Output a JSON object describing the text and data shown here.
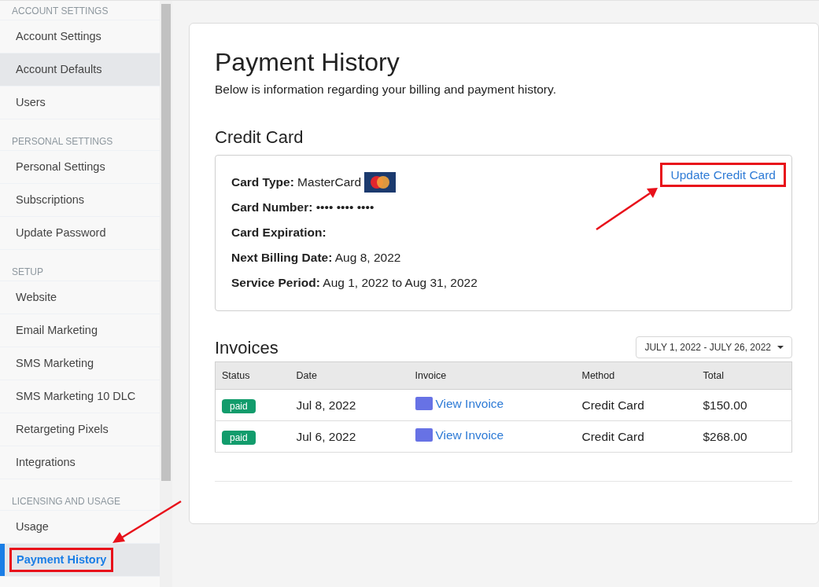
{
  "sidebar": {
    "sections": [
      {
        "title": "ACCOUNT SETTINGS",
        "items": [
          {
            "label": "Account Settings",
            "selected": false,
            "hovered": false,
            "outlined": false
          },
          {
            "label": "Account Defaults",
            "selected": false,
            "hovered": true,
            "outlined": false
          },
          {
            "label": "Users",
            "selected": false,
            "hovered": false,
            "outlined": false
          }
        ]
      },
      {
        "title": "PERSONAL SETTINGS",
        "items": [
          {
            "label": "Personal Settings",
            "selected": false,
            "hovered": false,
            "outlined": false
          },
          {
            "label": "Subscriptions",
            "selected": false,
            "hovered": false,
            "outlined": false
          },
          {
            "label": "Update Password",
            "selected": false,
            "hovered": false,
            "outlined": false
          }
        ]
      },
      {
        "title": "SETUP",
        "items": [
          {
            "label": "Website",
            "selected": false,
            "hovered": false,
            "outlined": false
          },
          {
            "label": "Email Marketing",
            "selected": false,
            "hovered": false,
            "outlined": false
          },
          {
            "label": "SMS Marketing",
            "selected": false,
            "hovered": false,
            "outlined": false
          },
          {
            "label": "SMS Marketing 10 DLC",
            "selected": false,
            "hovered": false,
            "outlined": false
          },
          {
            "label": "Retargeting Pixels",
            "selected": false,
            "hovered": false,
            "outlined": false
          },
          {
            "label": "Integrations",
            "selected": false,
            "hovered": false,
            "outlined": false
          }
        ]
      },
      {
        "title": "LICENSING AND USAGE",
        "items": [
          {
            "label": "Usage",
            "selected": false,
            "hovered": false,
            "outlined": false
          },
          {
            "label": "Payment History",
            "selected": true,
            "hovered": false,
            "outlined": true
          }
        ]
      }
    ]
  },
  "page": {
    "title": "Payment History",
    "subtitle": "Below is information regarding your billing and payment history."
  },
  "credit_card": {
    "heading": "Credit Card",
    "update_link": {
      "label": "Update Credit Card",
      "outlined": true
    },
    "details": [
      {
        "kind": "card-type",
        "text": "**Card Type:** MasterCard"
      },
      {
        "kind": "text",
        "text": "**Card Number:** •••• •••• ••••"
      },
      {
        "kind": "text",
        "text": "**Card Expiration:**"
      },
      {
        "kind": "text",
        "text": "**Next Billing Date:** Aug 8, 2022"
      },
      {
        "kind": "text",
        "text": "**Service Period:** Aug 1, 2022 to Aug 31, 2022"
      }
    ]
  },
  "invoices": {
    "heading": "Invoices",
    "date_range": "JULY 1, 2022 - JULY 26, 2022",
    "columns": [
      "Status",
      "Date",
      "Invoice",
      "Method",
      "Total"
    ],
    "rows": [
      {
        "status": "paid",
        "date": "Jul 8, 2022",
        "invoice": "View Invoice",
        "method": "Credit Card",
        "total": "$150.00"
      },
      {
        "status": "paid",
        "date": "Jul 6, 2022",
        "invoice": "View Invoice",
        "method": "Credit Card",
        "total": "$268.00"
      }
    ]
  }
}
